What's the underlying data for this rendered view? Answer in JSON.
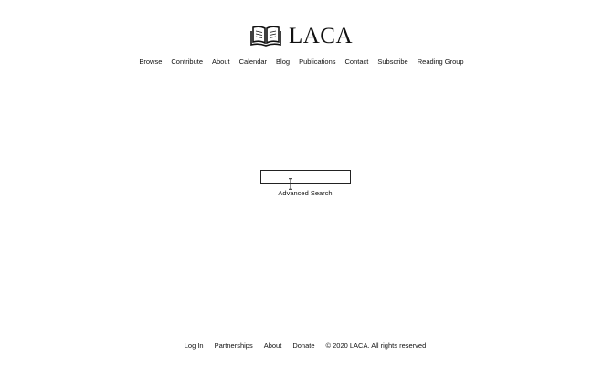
{
  "site": {
    "name": "LACA",
    "logo_icon": "open-book-icon"
  },
  "nav": {
    "items": [
      {
        "label": "Browse"
      },
      {
        "label": "Contribute"
      },
      {
        "label": "About"
      },
      {
        "label": "Calendar"
      },
      {
        "label": "Blog"
      },
      {
        "label": "Publications"
      },
      {
        "label": "Contact"
      },
      {
        "label": "Subscribe"
      },
      {
        "label": "Reading Group"
      }
    ]
  },
  "search": {
    "value": "",
    "advanced_label": "Advanced Search"
  },
  "cursor": {
    "icon": "text-cursor-icon"
  },
  "footer": {
    "links": [
      {
        "label": "Log In"
      },
      {
        "label": "Partnerships"
      },
      {
        "label": "About"
      },
      {
        "label": "Donate"
      }
    ],
    "copyright": "© 2020 LACA. All rights reserved"
  },
  "colors": {
    "background": "#ffffff",
    "text": "#111111",
    "border": "#222222"
  }
}
